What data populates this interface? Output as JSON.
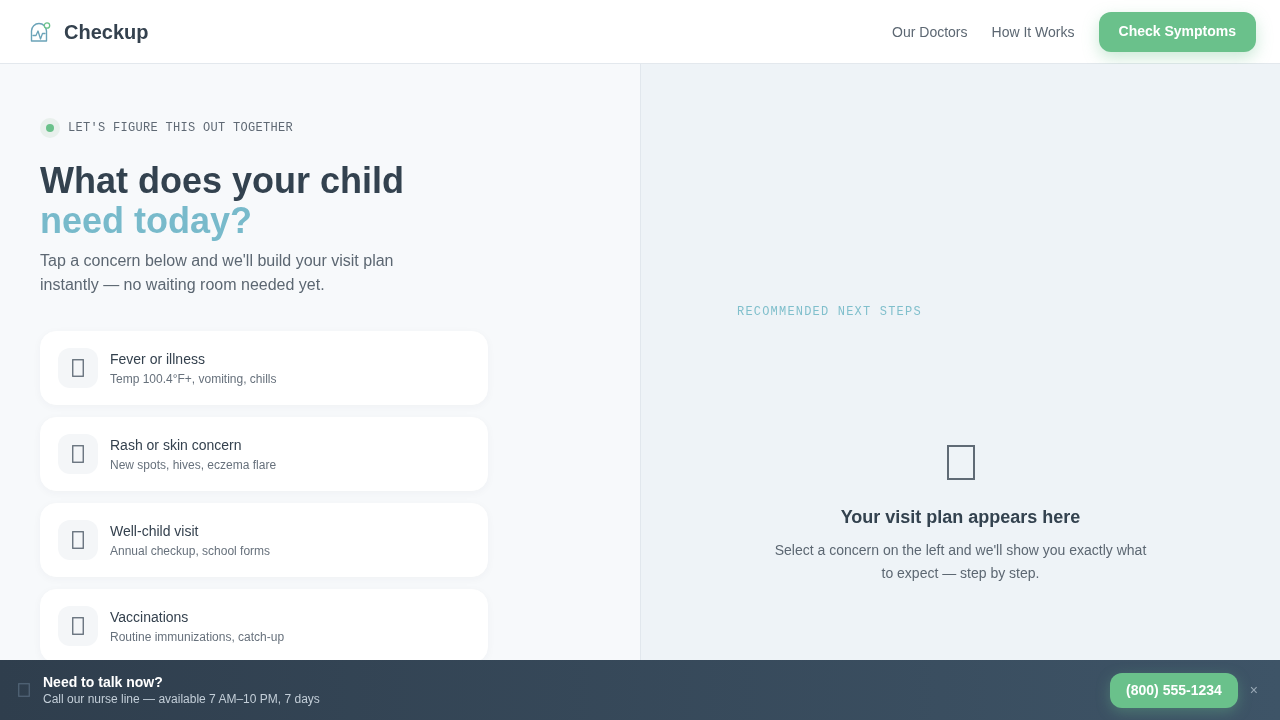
{
  "header": {
    "brand": "Checkup",
    "nav_links": [
      "Our Doctors",
      "How It Works"
    ],
    "cta": "Check Symptoms"
  },
  "hero": {
    "eyebrow": "LET'S FIGURE THIS OUT TOGETHER",
    "title": "What does your child",
    "title_highlight": "need today?",
    "intro": "Tap a concern below and we'll build your visit plan instantly — no waiting room needed yet."
  },
  "concerns": [
    {
      "title": "Fever or illness",
      "detail": "Temp 100.4°F+, vomiting, chills",
      "selected": false
    },
    {
      "title": "Rash or skin concern",
      "detail": "New spots, hives, eczema flare",
      "selected": false
    },
    {
      "title": "Well-child visit",
      "detail": "Annual checkup, school forms",
      "selected": false
    },
    {
      "title": "Vaccinations",
      "detail": "Routine immunizations, catch-up",
      "selected": false
    }
  ],
  "plan_panel": {
    "label": "RECOMMENDED NEXT STEPS",
    "empty_title": "Your visit plan appears here",
    "empty_text": "Select a concern on the left and we'll show you exactly what to expect — step by step."
  },
  "nurse_bar": {
    "title": "Need to talk now?",
    "text": "Call our nurse line — available 7 AM–10 PM, 7 days",
    "phone": "(800) 555-1234",
    "close": "×"
  }
}
